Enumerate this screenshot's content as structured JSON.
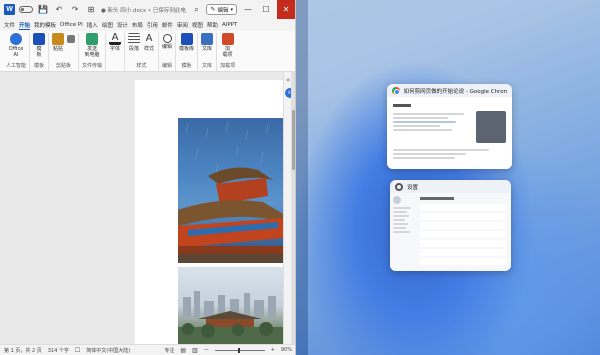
{
  "word": {
    "title_bar": {
      "document_title": "● 新头 四小.docx • 已保存到此电脑 ▾",
      "search_label": "⌕",
      "edit_mode": "编辑",
      "controls": {
        "minimize": "—",
        "maximize": "☐",
        "close": "✕"
      },
      "autosave_hint": "⟳",
      "undo": "↶",
      "redo": "↷",
      "save": "💾",
      "extra": "⊞"
    },
    "tabs": [
      "文件",
      "开始",
      "我的模板",
      "Office PI",
      "插入",
      "绘图",
      "设计",
      "布局",
      "引用",
      "邮件",
      "审阅",
      "视图",
      "帮助",
      "AIPPT"
    ],
    "active_tab": "开始",
    "ribbon": {
      "groups": [
        {
          "name": "人工智能",
          "items": [
            {
              "label": "Office\nAI",
              "color": "#2f6fd8"
            }
          ]
        },
        {
          "name": "模板",
          "items": [
            {
              "label": "模\n板",
              "color": "#1d4fb8"
            }
          ]
        },
        {
          "name": "剪贴板",
          "items": [
            {
              "label": "粘贴",
              "color": "#c68a1d"
            },
            {
              "label": "",
              "color": "#555555"
            }
          ]
        },
        {
          "name": "文件传输",
          "items": [
            {
              "label": "发送\n到电脑",
              "color": "#2f9e6e"
            }
          ]
        },
        {
          "name": "",
          "items": [
            {
              "label": "字体",
              "color": "#333333"
            }
          ]
        },
        {
          "name": "样式",
          "items": [
            {
              "label": "段落",
              "color": "#333333"
            },
            {
              "label": "样式",
              "color": "#333333"
            }
          ]
        },
        {
          "name": "编辑",
          "items": [
            {
              "label": "编辑",
              "color": "#333333"
            }
          ]
        },
        {
          "name": "模板",
          "items": [
            {
              "label": "模板库",
              "color": "#1d4fb8"
            }
          ]
        },
        {
          "name": "文库",
          "items": [
            {
              "label": "文库",
              "color": "#3b6fc0"
            }
          ]
        },
        {
          "name": "加载项",
          "items": [
            {
              "label": "加\n载项",
              "color": "#d04a2a"
            }
          ]
        }
      ],
      "collapse_icon": "⌄"
    },
    "side_panel": {
      "copilot_label": "AI",
      "collapse_label": "«"
    },
    "status_bar": {
      "page": "第 1 页，共 2 页",
      "words": "314 个字",
      "language": "简体中文(中国大陆)",
      "focus": "专注",
      "zoom": "90%",
      "zoom_minus": "—",
      "zoom_plus": "+"
    }
  },
  "snap": {
    "chrome_window": {
      "title": "如何剪网页做的开始论说 - Google Chrome",
      "app": "Google Chrome"
    },
    "settings_window": {
      "title": "设置",
      "app": "Settings"
    }
  }
}
